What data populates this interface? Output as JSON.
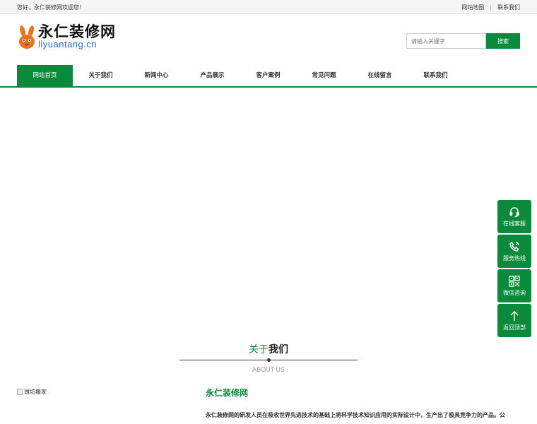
{
  "topbar": {
    "welcome": "您好，永仁装修网欢迎您！",
    "sitemap": "网站地图",
    "separator": "|",
    "contact": "联系我们"
  },
  "logo": {
    "name": "永仁装修网",
    "domain": "liyuantang.cn"
  },
  "search": {
    "placeholder": "请输入关键字",
    "button": "搜索"
  },
  "nav": [
    {
      "label": "网站首页",
      "active": true
    },
    {
      "label": "关于我们"
    },
    {
      "label": "新闻中心"
    },
    {
      "label": "产品展示"
    },
    {
      "label": "客户案例"
    },
    {
      "label": "常见问题"
    },
    {
      "label": "在线留言"
    },
    {
      "label": "联系我们"
    }
  ],
  "about": {
    "title_green": "关于",
    "title_black": "我们",
    "subtitle": "ABOUT US",
    "image_alt": "潍坊搬家",
    "name": "永仁装修网",
    "text": "永仁装修网的研发人员在吸收世界先进技术的基础上将科学技术知识应用的实际设计中，生产出了极具竞争力的产品。公"
  },
  "float_bar": [
    {
      "label": "在线客服",
      "icon": "headset-icon"
    },
    {
      "label": "服务热线",
      "icon": "phone-icon"
    },
    {
      "label": "微信咨询",
      "icon": "qrcode-icon"
    },
    {
      "label": "返回顶部",
      "icon": "arrow-up-icon"
    }
  ],
  "colors": {
    "brand_green": "#0a8a3a",
    "logo_blue": "#1e6ec8"
  }
}
